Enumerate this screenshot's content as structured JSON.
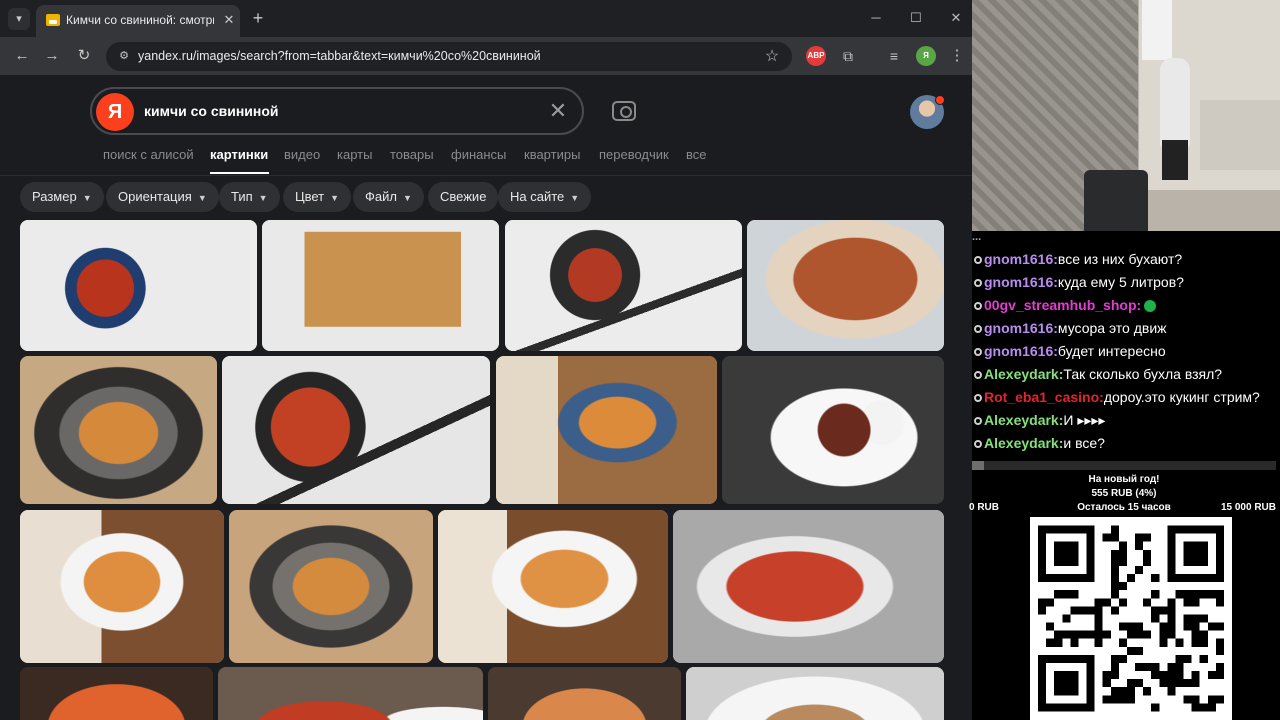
{
  "browser": {
    "tab_title": "Кимчи со свининой: смотрите",
    "url": "yandex.ru/images/search?from=tabbar&text=кимчи%20со%20свининой",
    "extensions": [
      {
        "name": "adblock-icon",
        "label": "ABP",
        "color": "#e33b3b"
      },
      {
        "name": "profile-icon",
        "label": "Я",
        "color": "#5aa546"
      }
    ]
  },
  "search": {
    "logo": "Я",
    "query": "кимчи со свининой"
  },
  "services": [
    "поиск с алисой",
    "картинки",
    "видео",
    "карты",
    "товары",
    "финансы",
    "квартиры",
    "переводчик",
    "все"
  ],
  "filters": [
    {
      "label": "Размер",
      "dropdown": true
    },
    {
      "label": "Ориентация",
      "dropdown": true
    },
    {
      "label": "Тип",
      "dropdown": true
    },
    {
      "label": "Цвет",
      "dropdown": true
    },
    {
      "label": "Файл",
      "dropdown": true
    },
    {
      "label": "Свежие",
      "dropdown": false
    },
    {
      "label": "На сайте",
      "dropdown": true
    }
  ],
  "chat": {
    "partial_line": "...",
    "messages": [
      {
        "user": "gnom1616",
        "text": "все из них бухают?",
        "color": "#b98cf0"
      },
      {
        "user": "gnom1616",
        "text": "куда ему 5 литров?",
        "color": "#b98cf0"
      },
      {
        "user": "00gv_streamhub_shop",
        "text": "",
        "color": "#e23dd0",
        "emote": true
      },
      {
        "user": "gnom1616",
        "text": "мусора это движ",
        "color": "#b98cf0"
      },
      {
        "user": "gnom1616",
        "text": "будет интересно",
        "color": "#b98cf0"
      },
      {
        "user": "Alexeydark",
        "text": "Так сколько бухла взял?",
        "color": "#86e07a"
      },
      {
        "user": "Rot_eba1_casino",
        "text": "дороу.это кукинг стрим?",
        "color": "#e2242f"
      },
      {
        "user": "Alexeydark",
        "text": "И ▸▸▸▸",
        "color": "#86e07a"
      },
      {
        "user": "Alexeydark",
        "text": "и все?",
        "color": "#86e07a"
      }
    ]
  },
  "goal": {
    "title": "На новый год!",
    "progress_text": "555 RUB (4%)",
    "progress_fraction": 0.04,
    "min_label": "0 RUB",
    "remaining": "Осталось 15 часов",
    "max_label": "15 000 RUB"
  }
}
